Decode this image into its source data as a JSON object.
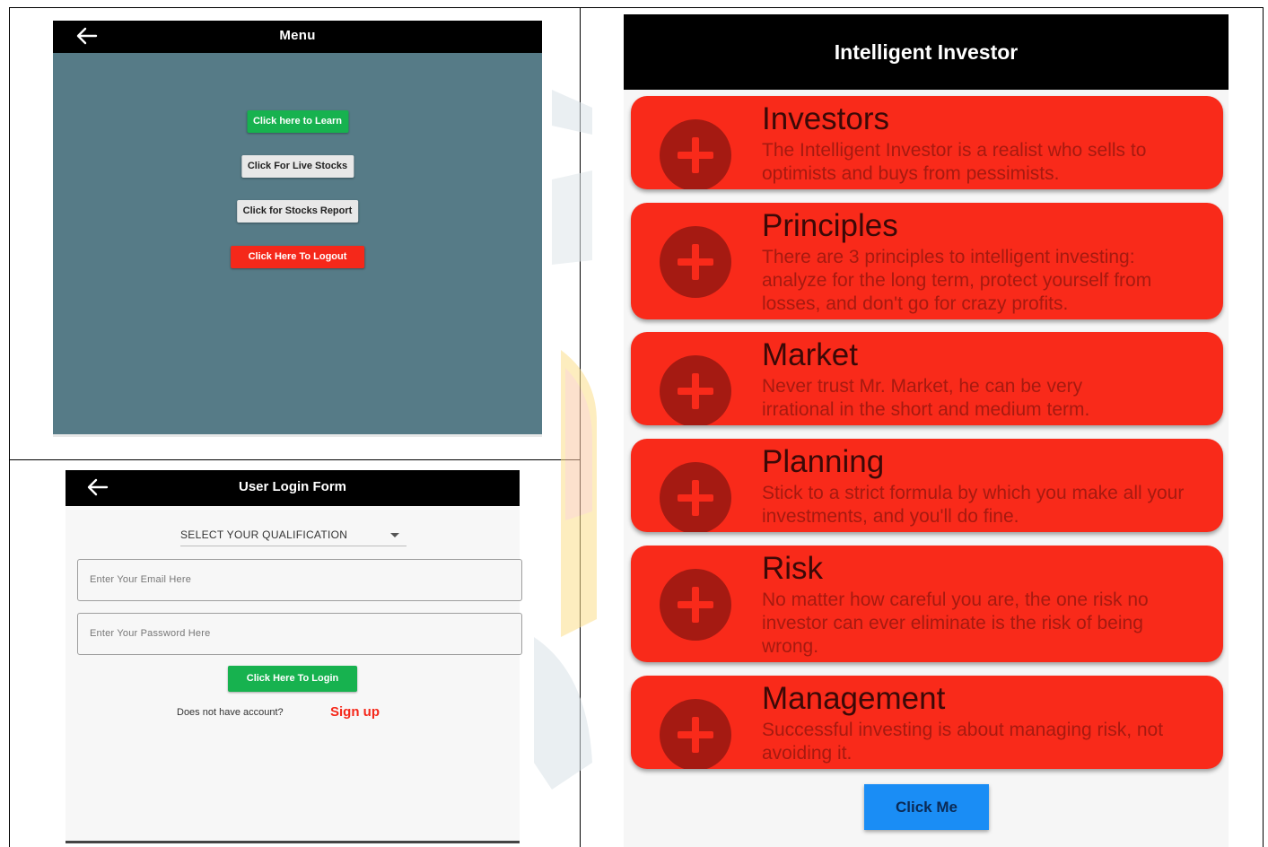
{
  "menu_screen": {
    "title": "Menu",
    "buttons": [
      {
        "label": "Click here to Learn",
        "color": "#17b24f"
      },
      {
        "label": "Click For Live Stocks",
        "color": "#e8e8e8"
      },
      {
        "label": "Click for Stocks Report",
        "color": "#e8e8e8"
      },
      {
        "label": "Click Here To Logout",
        "color": "#f5281a"
      }
    ],
    "background_color": "#567b87"
  },
  "login_screen": {
    "title": "User Login Form",
    "qualification_select": "SELECT YOUR QUALIFICATION",
    "email_placeholder": "Enter Your Email Here",
    "password_placeholder": "Enter Your Password Here",
    "login_button": "Click Here To Login",
    "no_account_text": "Does not have account?",
    "signup_link": "Sign up"
  },
  "investor_screen": {
    "title": "Intelligent Investor",
    "cards": [
      {
        "title": "Investors",
        "description": "The Intelligent Investor is a realist who sells to optimists and buys from pessimists."
      },
      {
        "title": "Principles",
        "description": "There are 3 principles to intelligent investing: analyze for the long term, protect yourself from losses, and don't go for crazy profits."
      },
      {
        "title": "Market",
        "description": "Never trust Mr. Market, he can be very irrational in the short and medium term."
      },
      {
        "title": "Planning",
        "description": "Stick to a strict formula by which you make all your investments, and you'll do fine."
      },
      {
        "title": "Risk",
        "description": "No matter how careful you are, the one risk no investor can ever eliminate is the risk of being wrong."
      },
      {
        "title": "Management",
        "description": "Successful investing is about managing risk, not avoiding it."
      }
    ],
    "click_button": "Click Me",
    "card_color": "#f92a1a",
    "icon": "plus-circle-icon"
  },
  "icons": {
    "back": "arrow-left-icon",
    "dropdown": "caret-down-icon"
  }
}
